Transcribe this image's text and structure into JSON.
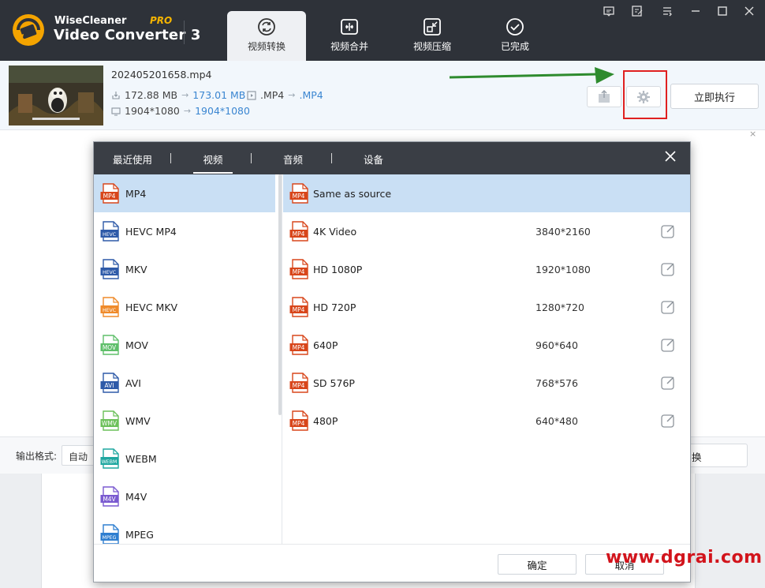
{
  "app": {
    "brand_top": "WiseCleaner",
    "brand_main": "Video Converter 3",
    "brand_badge": "PRO",
    "accent_color": "#3b86d1",
    "header_color": "#2e3239"
  },
  "main_tabs": [
    {
      "label": "视频转换",
      "icon": "convert-icon",
      "active": true
    },
    {
      "label": "视频合并",
      "icon": "merge-icon"
    },
    {
      "label": "视频压缩",
      "icon": "compress-icon"
    },
    {
      "label": "已完成",
      "icon": "check-circle-icon"
    }
  ],
  "window_controls": [
    "message-icon",
    "feedback-icon",
    "menu-icon",
    "minimize-icon",
    "maximize-icon",
    "close-icon"
  ],
  "file": {
    "name": "202405201658.mp4",
    "size_from": "172.88 MB",
    "size_to": "173.01 MB",
    "format_from": ".MP4",
    "format_to": ".MP4",
    "res_from": "1904*1080",
    "res_to": "1904*1080",
    "arrow": "→",
    "remove": "×"
  },
  "run_button": "立即执行",
  "bottom": {
    "output_label": "输出格式:",
    "output_value": "自动",
    "convert_button_fragment": "换"
  },
  "dialog": {
    "tabs": [
      {
        "label": "最近使用"
      },
      {
        "label": "视频",
        "active": true
      },
      {
        "label": "音频"
      },
      {
        "label": "设备"
      }
    ],
    "close": "×",
    "formats": [
      {
        "label": "MP4",
        "badge": "MP4",
        "color": "#d8461b",
        "active": true
      },
      {
        "label": "HEVC MP4",
        "badge": "HEVC",
        "color": "#2e5aa8"
      },
      {
        "label": "MKV",
        "badge": "HEVC",
        "color": "#2e5aa8"
      },
      {
        "label": "HEVC MKV",
        "badge": "HEVC",
        "color": "#ef8a2a"
      },
      {
        "label": "MOV",
        "badge": "MOV",
        "color": "#5fbf6a"
      },
      {
        "label": "AVI",
        "badge": "AVI",
        "color": "#2e5aa8"
      },
      {
        "label": "WMV",
        "badge": "WMV",
        "color": "#6cc05a"
      },
      {
        "label": "WEBM",
        "badge": "WEBM",
        "color": "#1fa7a0"
      },
      {
        "label": "M4V",
        "badge": "M4V",
        "color": "#7a5ad0"
      },
      {
        "label": "MPEG",
        "badge": "MPEG",
        "color": "#2e7ed0"
      }
    ],
    "presets": [
      {
        "label": "Same as source",
        "res": "",
        "active": true
      },
      {
        "label": "4K Video",
        "res": "3840*2160"
      },
      {
        "label": "HD 1080P",
        "res": "1920*1080"
      },
      {
        "label": "HD 720P",
        "res": "1280*720"
      },
      {
        "label": "640P",
        "res": "960*640"
      },
      {
        "label": "SD 576P",
        "res": "768*576"
      },
      {
        "label": "480P",
        "res": "640*480"
      }
    ],
    "preset_badge": "MP4",
    "ok": "确定",
    "cancel": "取消"
  },
  "watermark": "www.dgrai.com"
}
